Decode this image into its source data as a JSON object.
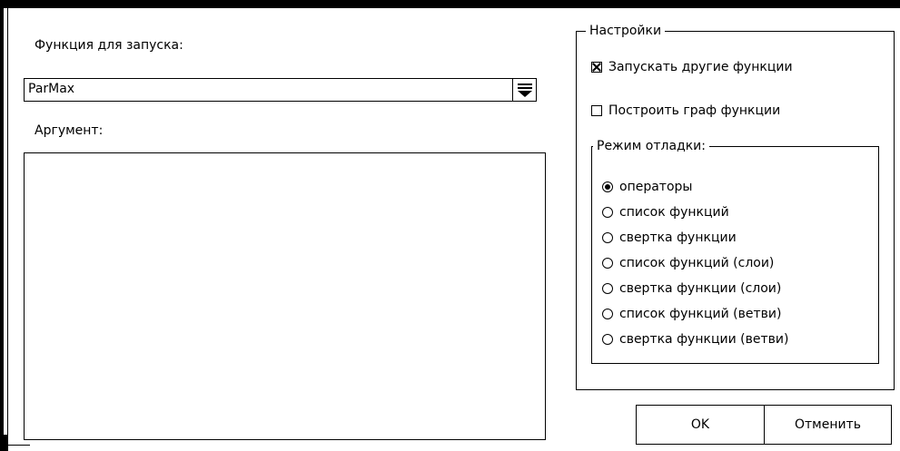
{
  "form": {
    "function_label": "Функция для запуска:",
    "function_value": "ParMax",
    "argument_label": "Аргумент:",
    "argument_value": ""
  },
  "settings": {
    "title": "Настройки",
    "run_other_functions": {
      "label": "Запускать другие функции",
      "checked": true
    },
    "build_function_graph": {
      "label": "Построить граф функции",
      "checked": false
    }
  },
  "debug_mode": {
    "title": "Режим отладки:",
    "options": [
      {
        "label": "операторы",
        "selected": true
      },
      {
        "label": "список функций",
        "selected": false
      },
      {
        "label": "свертка функции",
        "selected": false
      },
      {
        "label": "список функций (слои)",
        "selected": false
      },
      {
        "label": "свертка функции (слои)",
        "selected": false
      },
      {
        "label": "список функций (ветви)",
        "selected": false
      },
      {
        "label": "свертка функции (ветви)",
        "selected": false
      }
    ]
  },
  "buttons": {
    "ok": "OK",
    "cancel": "Отменить"
  },
  "icons": {
    "combo_arrow": "dropdown-arrow-icon"
  }
}
